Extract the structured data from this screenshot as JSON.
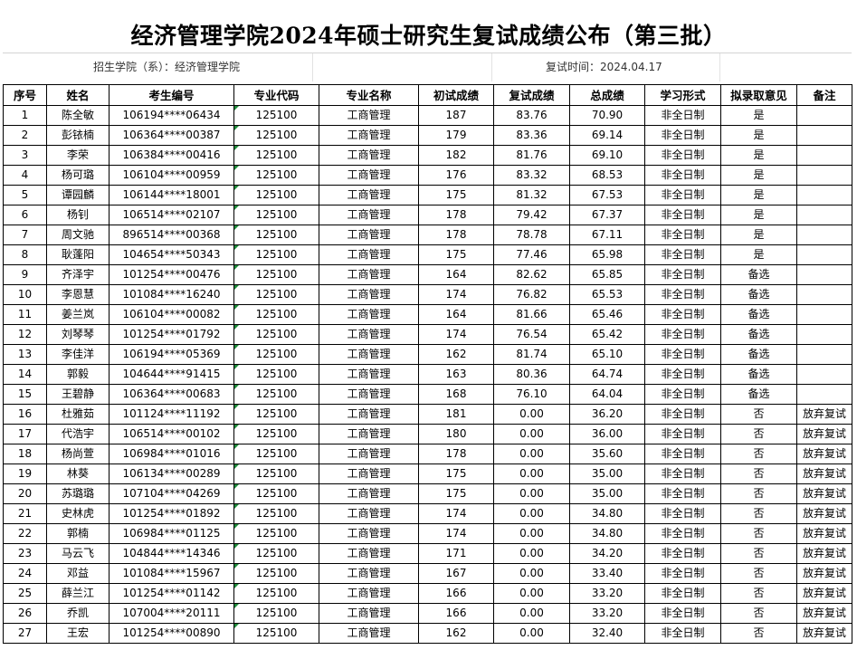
{
  "title": "经济管理学院2024年硕士研究生复试成绩公布（第三批）",
  "college_line": "招生学院（系）：经济管理学院",
  "date_line": "复试时间：2024.04.17",
  "columns": [
    "序号",
    "姓名",
    "考生编号",
    "专业代码",
    "专业名称",
    "初试成绩",
    "复试成绩",
    "总成绩",
    "学习形式",
    "拟录取意见",
    "备注"
  ],
  "rows": [
    [
      "1",
      "陈全敏",
      "106194****06434",
      "125100",
      "工商管理",
      "187",
      "83.76",
      "70.90",
      "非全日制",
      "是",
      ""
    ],
    [
      "2",
      "彭铱楠",
      "106364****00387",
      "125100",
      "工商管理",
      "179",
      "83.36",
      "69.14",
      "非全日制",
      "是",
      ""
    ],
    [
      "3",
      "李荣",
      "106384****00416",
      "125100",
      "工商管理",
      "182",
      "81.76",
      "69.10",
      "非全日制",
      "是",
      ""
    ],
    [
      "4",
      "杨可璐",
      "106104****00959",
      "125100",
      "工商管理",
      "176",
      "83.32",
      "68.53",
      "非全日制",
      "是",
      ""
    ],
    [
      "5",
      "谭园麟",
      "106144****18001",
      "125100",
      "工商管理",
      "175",
      "81.32",
      "67.53",
      "非全日制",
      "是",
      ""
    ],
    [
      "6",
      "杨钊",
      "106514****02107",
      "125100",
      "工商管理",
      "178",
      "79.42",
      "67.37",
      "非全日制",
      "是",
      ""
    ],
    [
      "7",
      "周文驰",
      "896514****00368",
      "125100",
      "工商管理",
      "178",
      "78.78",
      "67.11",
      "非全日制",
      "是",
      ""
    ],
    [
      "8",
      "耿蓬阳",
      "104654****50343",
      "125100",
      "工商管理",
      "175",
      "77.46",
      "65.98",
      "非全日制",
      "是",
      ""
    ],
    [
      "9",
      "齐泽宇",
      "101254****00476",
      "125100",
      "工商管理",
      "164",
      "82.62",
      "65.85",
      "非全日制",
      "备选",
      ""
    ],
    [
      "10",
      "李恩慧",
      "101084****16240",
      "125100",
      "工商管理",
      "174",
      "76.82",
      "65.53",
      "非全日制",
      "备选",
      ""
    ],
    [
      "11",
      "姜兰岚",
      "106104****00082",
      "125100",
      "工商管理",
      "164",
      "81.66",
      "65.46",
      "非全日制",
      "备选",
      ""
    ],
    [
      "12",
      "刘琴琴",
      "101254****01792",
      "125100",
      "工商管理",
      "174",
      "76.54",
      "65.42",
      "非全日制",
      "备选",
      ""
    ],
    [
      "13",
      "李佳洋",
      "106194****05369",
      "125100",
      "工商管理",
      "162",
      "81.74",
      "65.10",
      "非全日制",
      "备选",
      ""
    ],
    [
      "14",
      "郭毅",
      "104644****91415",
      "125100",
      "工商管理",
      "163",
      "80.36",
      "64.74",
      "非全日制",
      "备选",
      ""
    ],
    [
      "15",
      "王碧静",
      "106364****00683",
      "125100",
      "工商管理",
      "168",
      "76.10",
      "64.04",
      "非全日制",
      "备选",
      ""
    ],
    [
      "16",
      "杜雅茹",
      "101124****11192",
      "125100",
      "工商管理",
      "181",
      "0.00",
      "36.20",
      "非全日制",
      "否",
      "放弃复试"
    ],
    [
      "17",
      "代浩宇",
      "106514****00102",
      "125100",
      "工商管理",
      "180",
      "0.00",
      "36.00",
      "非全日制",
      "否",
      "放弃复试"
    ],
    [
      "18",
      "杨尚萱",
      "106984****01016",
      "125100",
      "工商管理",
      "178",
      "0.00",
      "35.60",
      "非全日制",
      "否",
      "放弃复试"
    ],
    [
      "19",
      "林葵",
      "106134****00289",
      "125100",
      "工商管理",
      "175",
      "0.00",
      "35.00",
      "非全日制",
      "否",
      "放弃复试"
    ],
    [
      "20",
      "苏璐璐",
      "107104****04269",
      "125100",
      "工商管理",
      "175",
      "0.00",
      "35.00",
      "非全日制",
      "否",
      "放弃复试"
    ],
    [
      "21",
      "史林虎",
      "101254****01892",
      "125100",
      "工商管理",
      "174",
      "0.00",
      "34.80",
      "非全日制",
      "否",
      "放弃复试"
    ],
    [
      "22",
      "郭楠",
      "106984****01125",
      "125100",
      "工商管理",
      "174",
      "0.00",
      "34.80",
      "非全日制",
      "否",
      "放弃复试"
    ],
    [
      "23",
      "马云飞",
      "104844****14346",
      "125100",
      "工商管理",
      "171",
      "0.00",
      "34.20",
      "非全日制",
      "否",
      "放弃复试"
    ],
    [
      "24",
      "邓益",
      "101084****15967",
      "125100",
      "工商管理",
      "167",
      "0.00",
      "33.40",
      "非全日制",
      "否",
      "放弃复试"
    ],
    [
      "25",
      "薛兰江",
      "101254****01142",
      "125100",
      "工商管理",
      "166",
      "0.00",
      "33.20",
      "非全日制",
      "否",
      "放弃复试"
    ],
    [
      "26",
      "乔凯",
      "107004****20111",
      "125100",
      "工商管理",
      "166",
      "0.00",
      "33.20",
      "非全日制",
      "否",
      "放弃复试"
    ],
    [
      "27",
      "王宏",
      "101254****00890",
      "125100",
      "工商管理",
      "162",
      "0.00",
      "32.40",
      "非全日制",
      "否",
      "放弃复试"
    ]
  ]
}
